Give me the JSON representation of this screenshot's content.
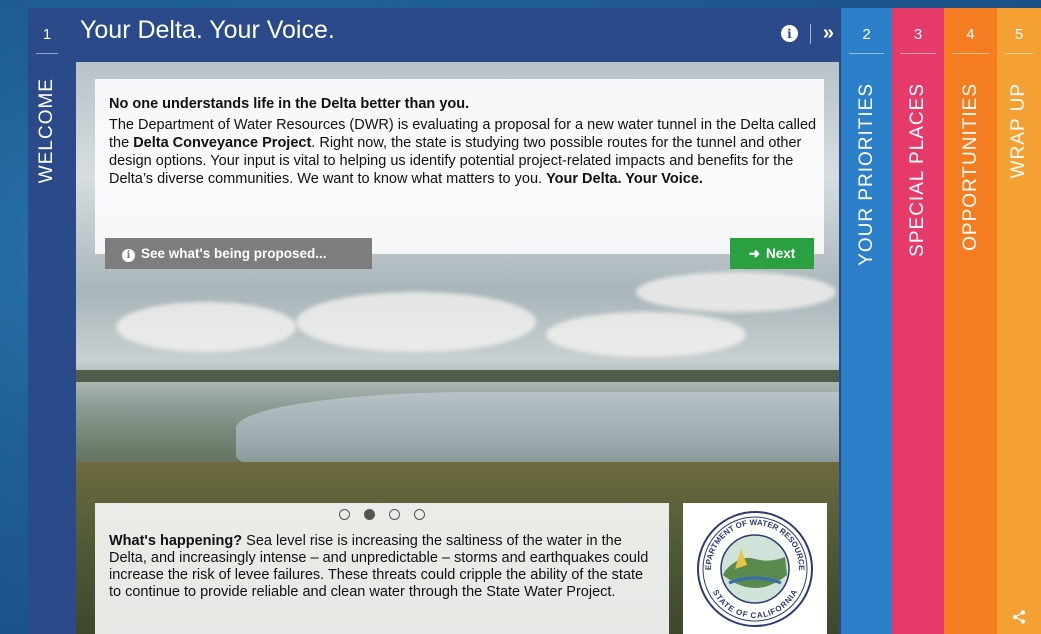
{
  "welcome": {
    "number": "1",
    "label": "WELCOME",
    "title": "Your Delta. Your Voice."
  },
  "intro": {
    "heading": "No one understands life in the Delta better than you.",
    "body_part1": "The Department of Water Resources (DWR) is evaluating a proposal for a new water tunnel in the Delta called the ",
    "body_bold1": "Delta Conveyance Project",
    "body_part2": ". Right now, the state is studying two possible routes for the tunnel and other design options. Your input is vital to helping us identify potential project-related impacts and benefits for the Delta’s diverse communities. We want to know what matters to you. ",
    "body_bold2": "Your Delta. Your Voice."
  },
  "buttons": {
    "proposed_label": "See what's being proposed...",
    "next_label": "Next"
  },
  "carousel": {
    "slide_count": 4,
    "active_index": 1
  },
  "happening": {
    "lead": "What's happening?",
    "text": " Sea level rise is increasing the saltiness of the water in the Delta, and increasingly intense – and unpredictable – storms and earthquakes could increase the risk of levee failures. These threats could cripple the ability of the state to continue to provide reliable and clean water through the State Water Project."
  },
  "seal": {
    "top_text": "DEPARTMENT OF WATER RESOURCES",
    "bottom_text": "STATE OF CALIFORNIA"
  },
  "tabs": [
    {
      "number": "2",
      "label": "YOUR PRIORITIES",
      "color": "#2c7fc9"
    },
    {
      "number": "3",
      "label": "SPECIAL PLACES",
      "color": "#e53a6a"
    },
    {
      "number": "4",
      "label": "OPPORTUNITIES",
      "color": "#f37d20"
    },
    {
      "number": "5",
      "label": "WRAP UP",
      "color": "#f5a032"
    }
  ],
  "colors": {
    "welcome_panel": "#2a4a8a",
    "next_button": "#2aa040",
    "proposed_button": "#7d7d7d"
  },
  "icons": [
    "info-icon",
    "double-chevron-right-icon",
    "arrow-right-icon",
    "share-icon"
  ]
}
